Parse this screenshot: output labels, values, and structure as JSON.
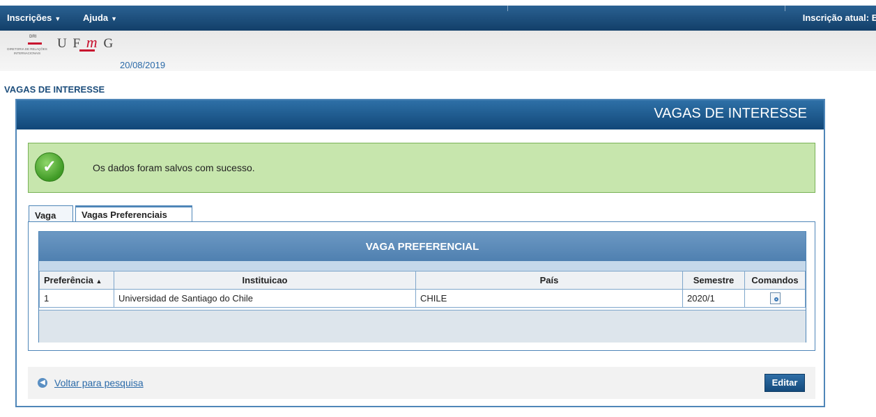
{
  "menu": {
    "items": [
      {
        "label": "Inscrições"
      },
      {
        "label": "Ajuda"
      }
    ],
    "current_registration": "Inscrição atual: El"
  },
  "header": {
    "logo_dri": "DRI",
    "logo_dri_text": "DIRETORIA DE RELAÇÕES INTERNACIONAIS",
    "logo_ufmg": "UFMG",
    "date": "20/08/2019"
  },
  "page": {
    "title": "VAGAS DE INTERESSE"
  },
  "panel": {
    "title": "VAGAS DE INTERESSE",
    "success_message": "Os dados foram salvos com sucesso.",
    "tabs": [
      {
        "label": "Vaga"
      },
      {
        "label": "Vagas Preferenciais"
      }
    ],
    "grid": {
      "title": "VAGA PREFERENCIAL",
      "columns": [
        "Preferência",
        "Instituicao",
        "País",
        "Semestre",
        "Comandos"
      ],
      "rows": [
        {
          "preferencia": "1",
          "instituicao": "Universidad de Santiago do Chile",
          "pais": "CHILE",
          "semestre": "2020/1",
          "comando_icon": "view-document-icon"
        }
      ]
    },
    "back_link": "Voltar para pesquisa",
    "edit_button": "Editar"
  }
}
